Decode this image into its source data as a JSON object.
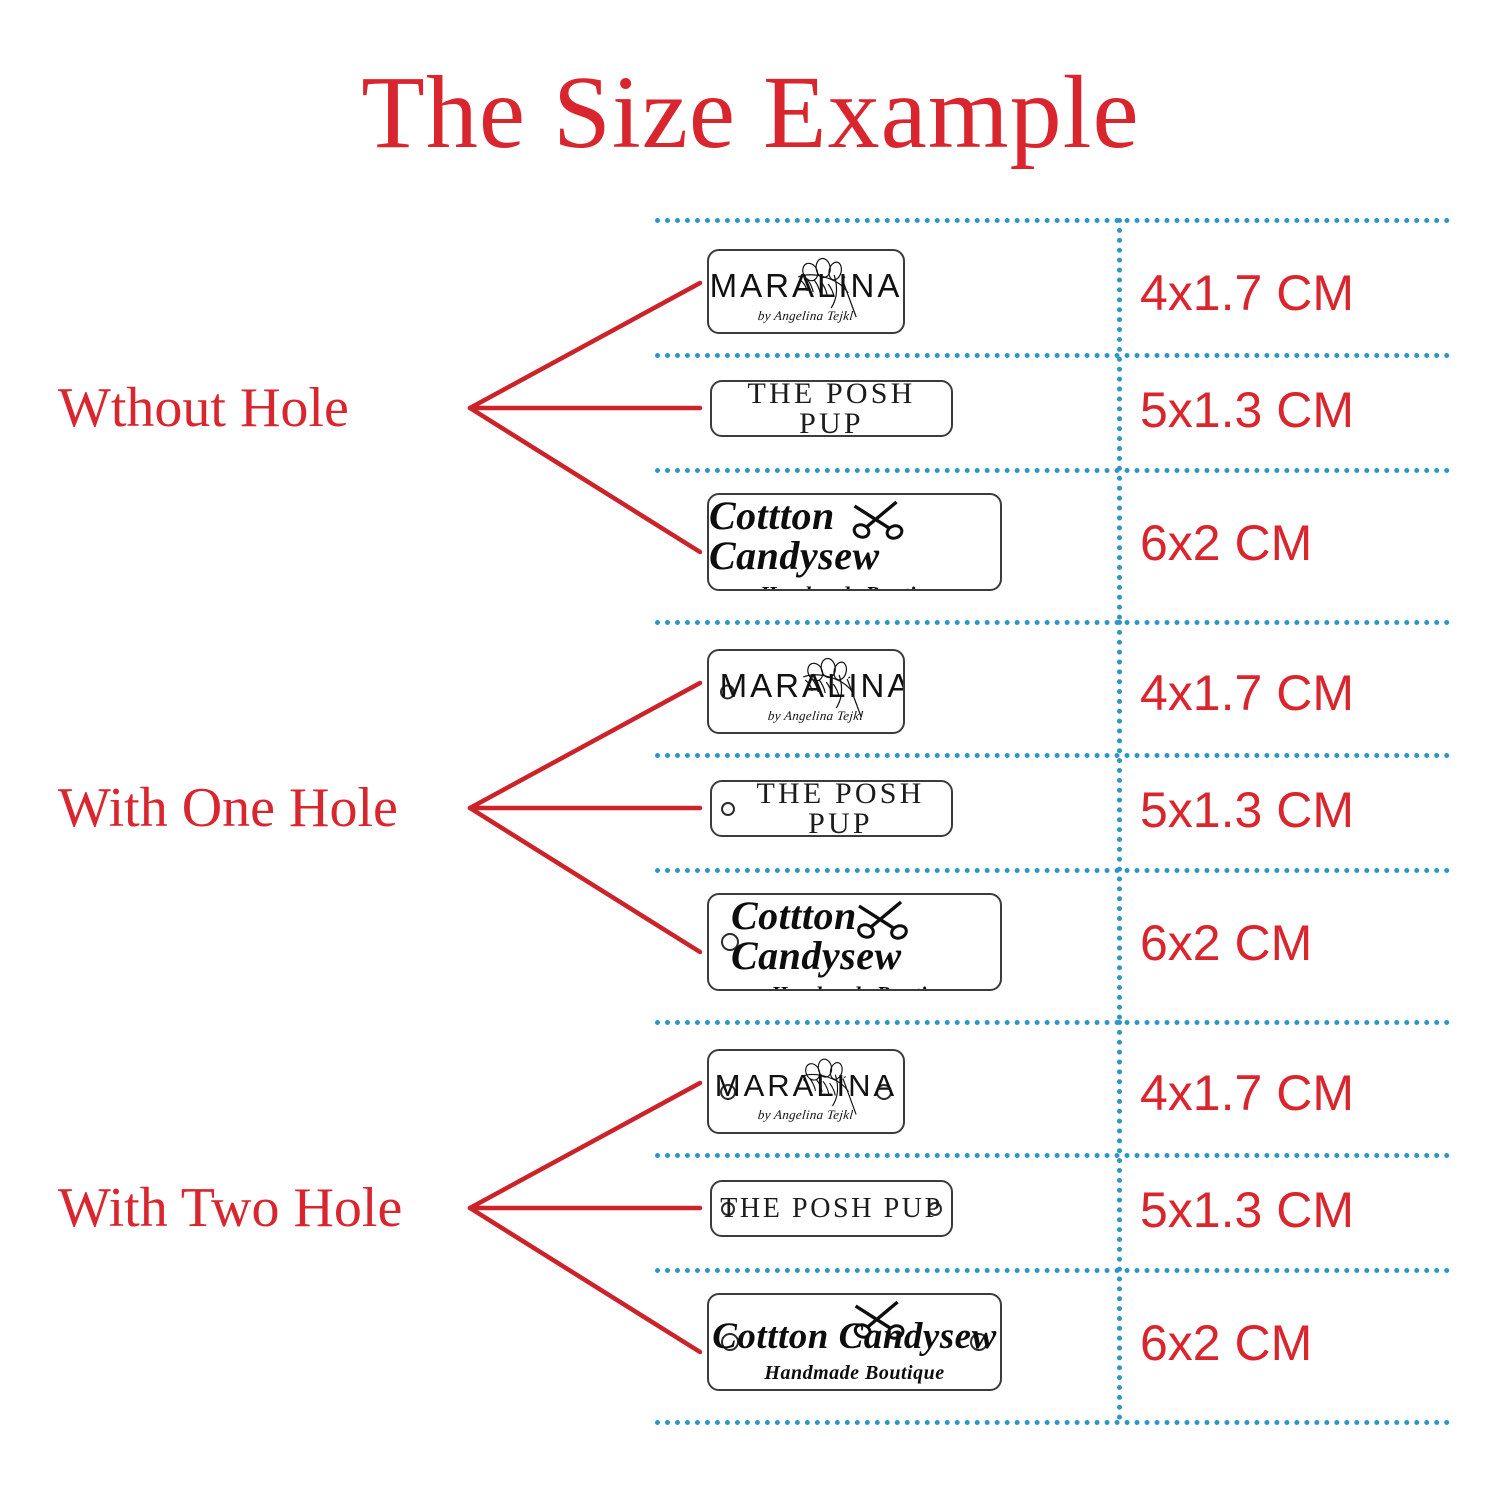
{
  "page": {
    "title": "The Size Example",
    "accent_red": "#d9262e",
    "grid_blue": "#2e96c4",
    "background": "#ffffff"
  },
  "categories": [
    {
      "label": "Wthout Hole",
      "holes": 0
    },
    {
      "label": "With One Hole",
      "holes": 1
    },
    {
      "label": "With Two Hole",
      "holes": 2
    }
  ],
  "sizes": {
    "maralina": "4x1.7 CM",
    "posh_pup": "5x1.3 CM",
    "candysew": "6x2 CM"
  },
  "labels": {
    "maralina": {
      "name": "MARALINA",
      "subtitle": "by Angelina Tejkl",
      "icon": "needle-thread-icon"
    },
    "posh_pup": {
      "name": "THE POSH PUP"
    },
    "candysew": {
      "name": "Cottton Candysew",
      "subtitle": "Handmade Boutique",
      "icon": "scissors-icon"
    }
  },
  "rows": [
    {
      "group": 0,
      "label": "maralina",
      "size": "4x1.7 CM"
    },
    {
      "group": 0,
      "label": "posh_pup",
      "size": "5x1.3 CM"
    },
    {
      "group": 0,
      "label": "candysew",
      "size": "6x2 CM"
    },
    {
      "group": 1,
      "label": "maralina",
      "size": "4x1.7 CM"
    },
    {
      "group": 1,
      "label": "posh_pup",
      "size": "5x1.3 CM"
    },
    {
      "group": 1,
      "label": "candysew",
      "size": "6x2 CM"
    },
    {
      "group": 2,
      "label": "maralina",
      "size": "4x1.7 CM"
    },
    {
      "group": 2,
      "label": "posh_pup",
      "size": "5x1.3 CM"
    },
    {
      "group": 2,
      "label": "candysew",
      "size": "6x2 CM"
    }
  ]
}
